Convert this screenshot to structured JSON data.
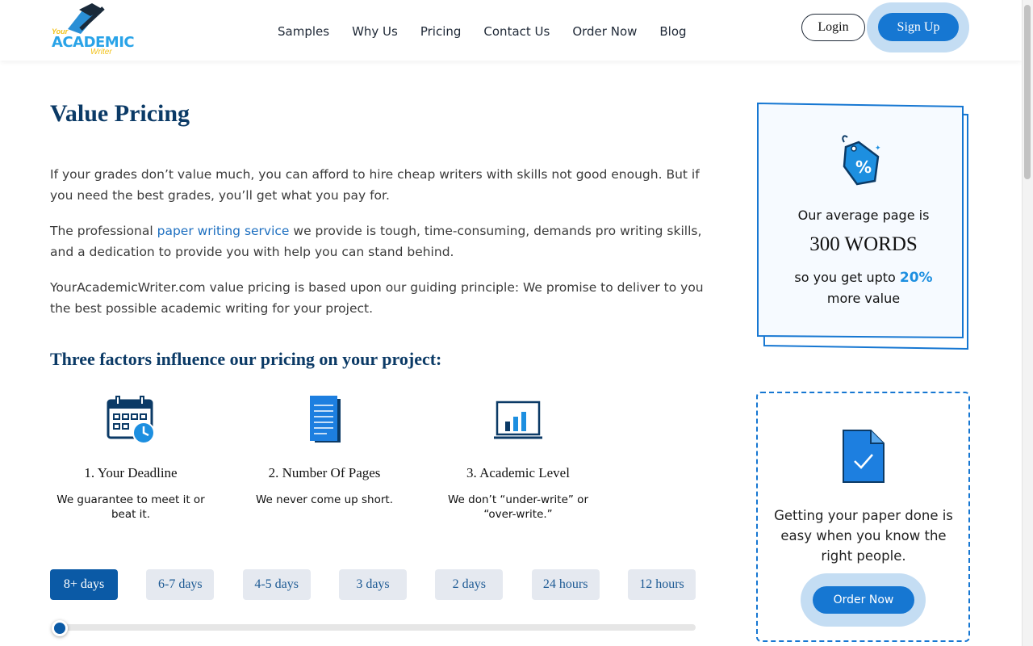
{
  "header": {
    "logo": {
      "line1": "Your",
      "line2": "ACADEMIC",
      "line3": "Writer"
    },
    "nav": [
      "Samples",
      "Why Us",
      "Pricing",
      "Contact Us",
      "Order Now",
      "Blog"
    ],
    "login_label": "Login",
    "signup_label": "Sign Up"
  },
  "main": {
    "title": "Value Pricing",
    "p1": "If your grades don’t value much, you can afford to hire cheap writers with skills not good enough. But if you need the best grades, you’ll get what you pay for.",
    "p2_before": "The professional ",
    "p2_link": "paper writing service",
    "p2_after": " we provide is tough, time-consuming, demands pro writing skills, and a dedication to provide you with help you can stand behind.",
    "p3": "YourAcademicWriter.com value pricing is based upon our guiding principle: We promise to deliver to you the best possible academic writing for your project.",
    "factors_title": "Three factors influence our pricing on your project:",
    "factors": [
      {
        "icon": "calendar-clock-icon",
        "title": "1. Your Deadline",
        "desc": "We guarantee to meet it or beat it."
      },
      {
        "icon": "document-pages-icon",
        "title": "2. Number Of Pages",
        "desc": "We never come up short."
      },
      {
        "icon": "bar-chart-monitor-icon",
        "title": "3. Academic Level",
        "desc": "We don’t “under-write” or “over-write.”"
      }
    ],
    "deadlines": [
      "8+ days",
      "6-7 days",
      "4-5 days",
      "3 days",
      "2 days",
      "24 hours",
      "12 hours"
    ],
    "selected_deadline": "8+ days"
  },
  "sidebar": {
    "card1": {
      "icon": "price-tag-percent-icon",
      "label": "Our average page is",
      "words": "300 WORDS",
      "note_before": "so you get upto ",
      "note_pct": "20%",
      "note_after": "more value"
    },
    "card2": {
      "icon": "document-check-icon",
      "text": "Getting your paper done is easy when you know the right people.",
      "order_label": "Order Now"
    }
  },
  "colors": {
    "brand_blue": "#1677d2",
    "navy": "#0b3a66",
    "active_tab": "#0b5aa6",
    "light_blue": "#c4ddf3"
  }
}
